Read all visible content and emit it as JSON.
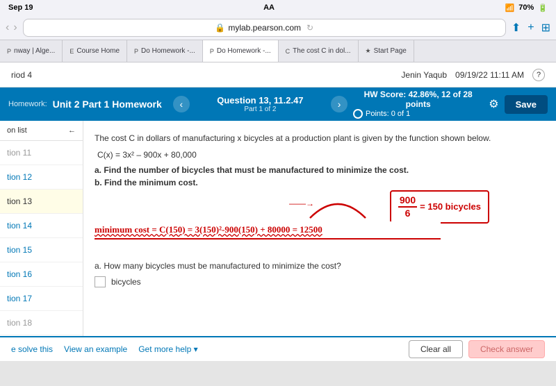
{
  "statusBar": {
    "time": "Sep 19",
    "center": "AA",
    "battery": "70%",
    "signal": "wifi"
  },
  "browserBar": {
    "url": "mylab.pearson.com",
    "lock": "🔒"
  },
  "tabs": [
    {
      "id": "tab-pathway",
      "label": "nway | Alge...",
      "icon": "P",
      "active": false
    },
    {
      "id": "tab-course",
      "label": "Course Home",
      "icon": "E",
      "active": false
    },
    {
      "id": "tab-hw1",
      "label": "Do Homework -...",
      "icon": "P",
      "active": false
    },
    {
      "id": "tab-hw2",
      "label": "Do Homework -...",
      "icon": "P",
      "active": true
    },
    {
      "id": "tab-cost",
      "label": "The cost C in dol...",
      "icon": "C",
      "active": false
    },
    {
      "id": "tab-start",
      "label": "Start Page",
      "icon": "★",
      "active": false
    }
  ],
  "pageHeader": {
    "period": "riod 4",
    "user": "Jenin Yaqub",
    "date": "09/19/22 11:11 AM",
    "helpIcon": "?"
  },
  "hwHeader": {
    "hwLabel": "Homework:",
    "hwTitle": "Unit 2 Part 1 Homework",
    "questionNum": "Question 13, 11.2.47",
    "partInfo": "Part 1 of 2",
    "hwScore": "HW Score: 42.86%, 12 of 28 points",
    "points": "Points: 0 of 1",
    "saveLabel": "Save"
  },
  "sidebar": {
    "headerLabel": "on list",
    "backIcon": "←",
    "items": [
      {
        "id": "item-11",
        "label": "tion 11",
        "active": false
      },
      {
        "id": "item-12",
        "label": "tion 12",
        "active": false
      },
      {
        "id": "item-13",
        "label": "tion 13",
        "active": true
      },
      {
        "id": "item-14",
        "label": "tion 14",
        "active": false
      },
      {
        "id": "item-15",
        "label": "tion 15",
        "active": false
      },
      {
        "id": "item-16",
        "label": "tion 16",
        "active": false
      },
      {
        "id": "item-17",
        "label": "tion 17",
        "active": false
      },
      {
        "id": "item-18",
        "label": "tion 18",
        "active": false
      }
    ]
  },
  "problem": {
    "description": "The cost C in dollars of manufacturing x bicycles at a production plant is given by the function shown below.",
    "function": "C(x) = 3x² – 900x + 80,000",
    "partA": "a. Find the number of bicycles that must be manufactured to minimize the cost.",
    "partB": "b. Find the minimum cost.",
    "fractionNumerator": "900",
    "fractionDenominator": "6",
    "equalsBicycles": "= 150 bicycles",
    "hwEquation": "minimum cost = C(150) = 3(150)²-900(150) + 80000 = 12500",
    "questionPartA": "a. How many bicycles must be manufactured to minimize the cost?",
    "answerLabel": "bicycles"
  },
  "bottomBar": {
    "solveLink": "e solve this",
    "exampleLink": "View an example",
    "helpLink": "Get more help ▾",
    "clearAll": "Clear all",
    "checkAnswer": "Check answer"
  }
}
